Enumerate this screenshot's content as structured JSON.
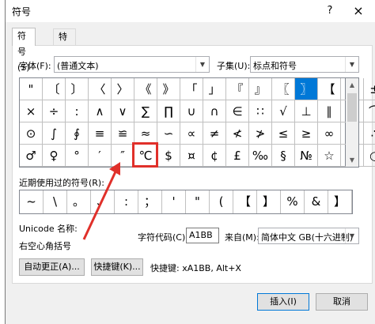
{
  "window": {
    "title": "符号",
    "help_label": "?",
    "close_label": "×"
  },
  "tabs": [
    {
      "label": "符号(S)"
    },
    {
      "label": "特殊字符(P)"
    }
  ],
  "font": {
    "label": "字体(F):",
    "value": "(普通文本)"
  },
  "subset": {
    "label": "子集(U):",
    "value": "标点和符号"
  },
  "symbol_grid": [
    [
      "\"",
      "〔",
      "〕",
      "〈",
      "〉",
      "《",
      "》",
      "「",
      "」",
      "『",
      "』",
      "〖",
      "〗",
      "【",
      "】",
      "±"
    ],
    [
      "×",
      "÷",
      ":",
      "∧",
      "∨",
      "∑",
      "∏",
      "∪",
      "∩",
      "∈",
      "∷",
      "√",
      "⊥",
      "∥",
      "∠",
      "⌒"
    ],
    [
      "⊙",
      "∫",
      "∮",
      "≡",
      "≌",
      "≈",
      "∽",
      "∝",
      "≠",
      "≮",
      "≯",
      "≤",
      "≥",
      "∞",
      "∵",
      "∴"
    ],
    [
      "♂",
      "♀",
      "°",
      "′",
      "″",
      "℃",
      "$",
      "¤",
      "¢",
      "£",
      "‰",
      "§",
      "№",
      "☆",
      "★",
      "○"
    ]
  ],
  "selected_symbol": "〗",
  "highlighted_symbol": "℃",
  "recent": {
    "label": "近期使用过的符号(R):",
    "symbols": [
      "~",
      "\\",
      "。",
      "、",
      ":",
      "；",
      "'",
      "\"",
      "(",
      "【",
      "】",
      "%",
      "&",
      "】"
    ]
  },
  "unicode_name": {
    "label": "Unicode 名称:",
    "value": "右空心角括号"
  },
  "char_code": {
    "label": "字符代码(C):",
    "value": "A1BB"
  },
  "from": {
    "label": "来自(M):",
    "value": "简体中文 GB(十六进制)"
  },
  "buttons": {
    "autocorrect": "自动更正(A)...",
    "shortcut_key": "快捷键(K)...",
    "insert": "插入(I)",
    "cancel": "取消"
  },
  "shortcut_text": "快捷键: xA1BB, Alt+X",
  "colors": {
    "selection": "#0078d7",
    "annotation": "#e0302a"
  }
}
